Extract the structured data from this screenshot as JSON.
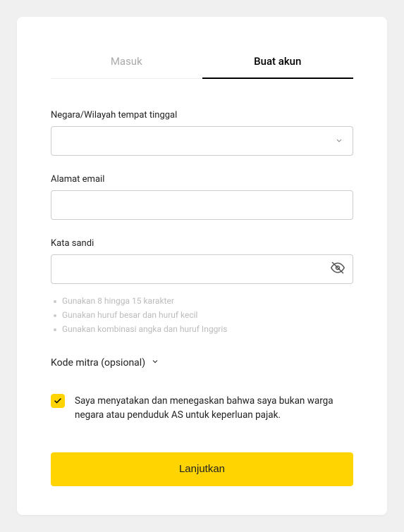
{
  "tabs": {
    "login": "Masuk",
    "signup": "Buat akun"
  },
  "fields": {
    "country": {
      "label": "Negara/Wilayah tempat tinggal",
      "value": ""
    },
    "email": {
      "label": "Alamat email",
      "value": ""
    },
    "password": {
      "label": "Kata sandi",
      "value": ""
    }
  },
  "password_hints": [
    "Gunakan 8 hingga 15 karakter",
    "Gunakan huruf besar dan huruf kecil",
    "Gunakan kombinasi angka dan huruf Inggris"
  ],
  "partner_code": {
    "label": "Kode mitra (opsional)"
  },
  "declaration": {
    "checked": true,
    "text": "Saya menyatakan dan menegaskan bahwa saya bukan warga negara atau penduduk AS untuk keperluan pajak."
  },
  "submit_label": "Lanjutkan"
}
